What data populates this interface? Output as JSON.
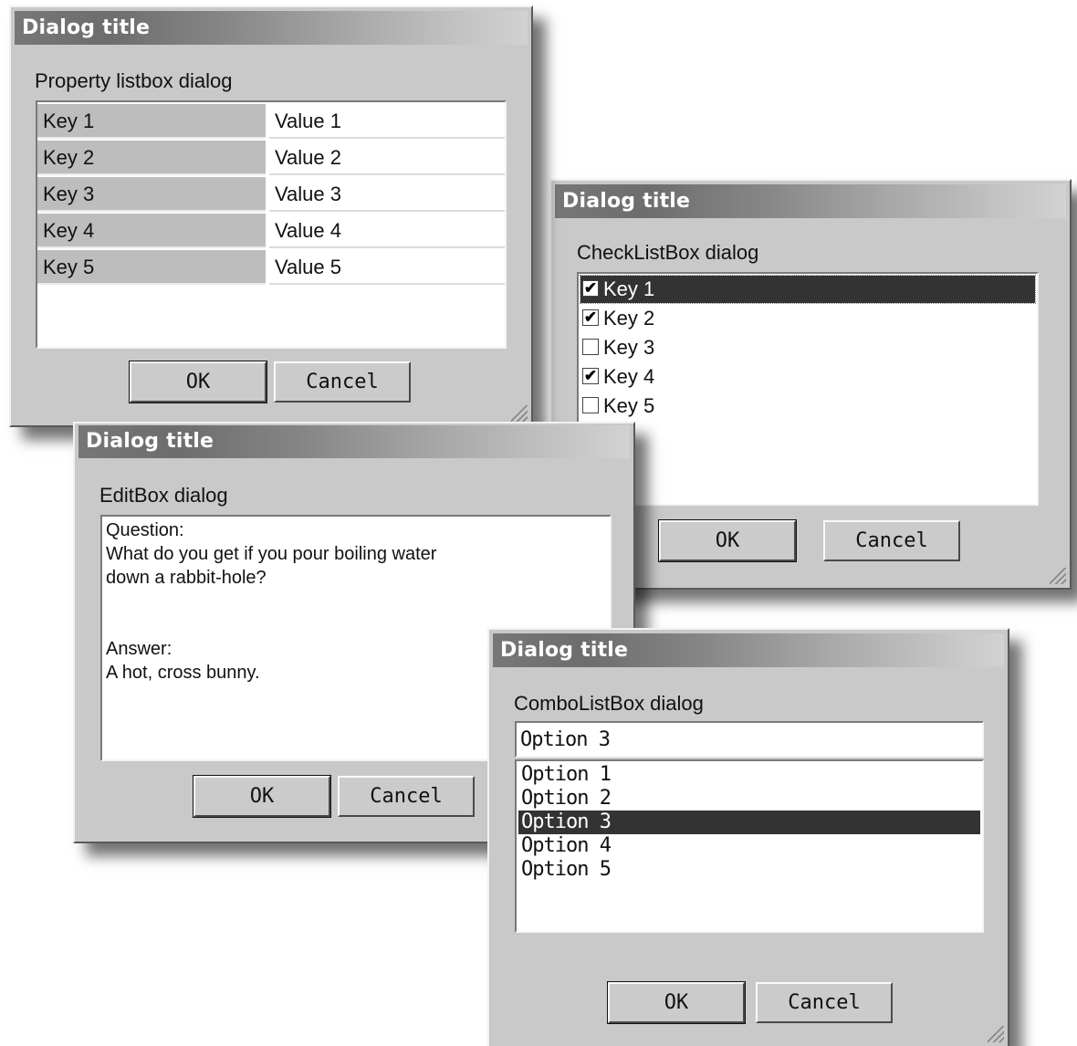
{
  "property_dialog": {
    "title": "Dialog title",
    "caption": "Property listbox dialog",
    "rows": [
      {
        "key": "Key 1",
        "value": "Value 1"
      },
      {
        "key": "Key 2",
        "value": "Value 2"
      },
      {
        "key": "Key 3",
        "value": "Value 3"
      },
      {
        "key": "Key 4",
        "value": "Value 4"
      },
      {
        "key": "Key 5",
        "value": "Value 5"
      }
    ],
    "ok_label": "OK",
    "cancel_label": "Cancel"
  },
  "checklist_dialog": {
    "title": "Dialog title",
    "caption": "CheckListBox dialog",
    "items": [
      {
        "label": "Key 1",
        "checked": true,
        "selected": true
      },
      {
        "label": "Key 2",
        "checked": true,
        "selected": false
      },
      {
        "label": "Key 3",
        "checked": false,
        "selected": false
      },
      {
        "label": "Key 4",
        "checked": true,
        "selected": false
      },
      {
        "label": "Key 5",
        "checked": false,
        "selected": false
      }
    ],
    "ok_label": "OK",
    "cancel_label": "Cancel"
  },
  "editbox_dialog": {
    "title": "Dialog title",
    "caption": "EditBox dialog",
    "text": "Question:\nWhat do you get if you pour boiling water\ndown a rabbit-hole?\n\n\nAnswer:\nA hot, cross bunny.",
    "ok_label": "OK",
    "cancel_label": "Cancel"
  },
  "combo_dialog": {
    "title": "Dialog title",
    "caption": "ComboListBox dialog",
    "input_value": "Option 3",
    "options": [
      "Option 1",
      "Option 2",
      "Option 3",
      "Option 4",
      "Option 5"
    ],
    "selected_index": 2,
    "ok_label": "OK",
    "cancel_label": "Cancel"
  }
}
